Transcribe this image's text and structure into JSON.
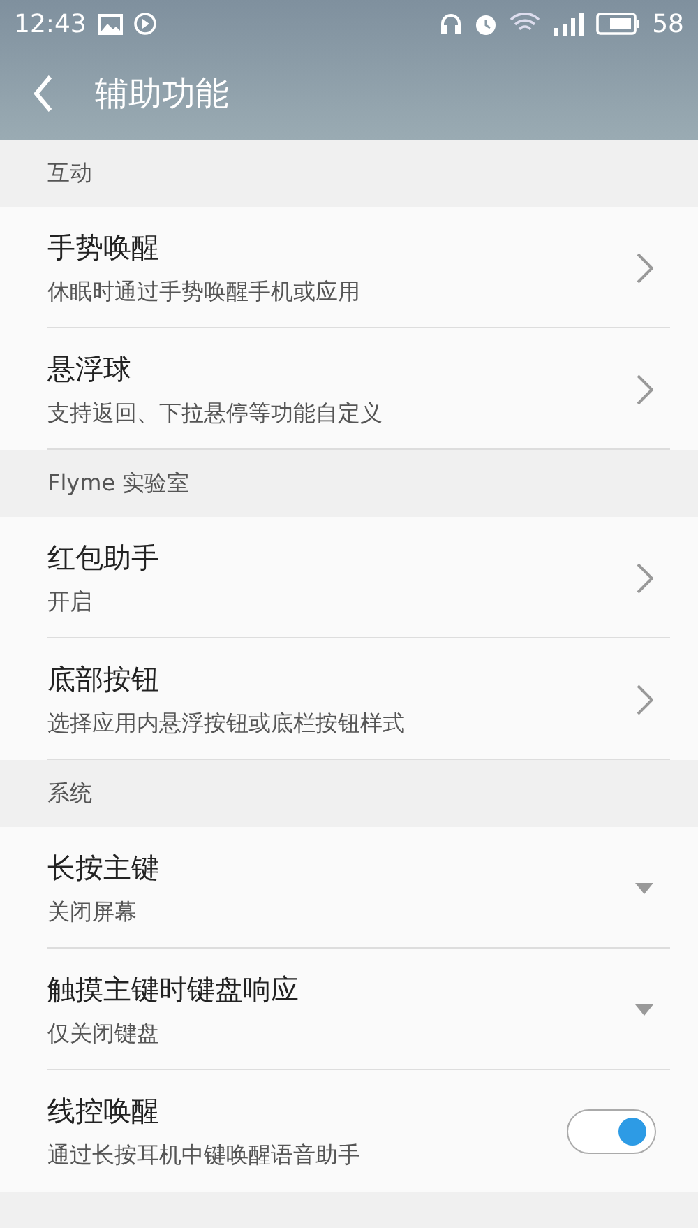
{
  "status_bar": {
    "time": "12:43",
    "battery_level": "58"
  },
  "header": {
    "title": "辅助功能"
  },
  "sections": [
    {
      "title": "互动",
      "items": [
        {
          "kind": "arrow",
          "title": "手势唤醒",
          "subtitle": "休眠时通过手势唤醒手机或应用"
        },
        {
          "kind": "arrow",
          "title": "悬浮球",
          "subtitle": "支持返回、下拉悬停等功能自定义"
        }
      ]
    },
    {
      "title": "Flyme 实验室",
      "items": [
        {
          "kind": "arrow",
          "title": "红包助手",
          "subtitle": "开启"
        },
        {
          "kind": "arrow",
          "title": "底部按钮",
          "subtitle": "选择应用内悬浮按钮或底栏按钮样式"
        }
      ]
    },
    {
      "title": "系统",
      "items": [
        {
          "kind": "dropdown",
          "title": "长按主键",
          "subtitle": "关闭屏幕"
        },
        {
          "kind": "dropdown",
          "title": "触摸主键时键盘响应",
          "subtitle": "仅关闭键盘"
        },
        {
          "kind": "switch",
          "title": "线控唤醒",
          "subtitle": "通过长按耳机中键唤醒语音助手",
          "on": true
        }
      ]
    }
  ]
}
